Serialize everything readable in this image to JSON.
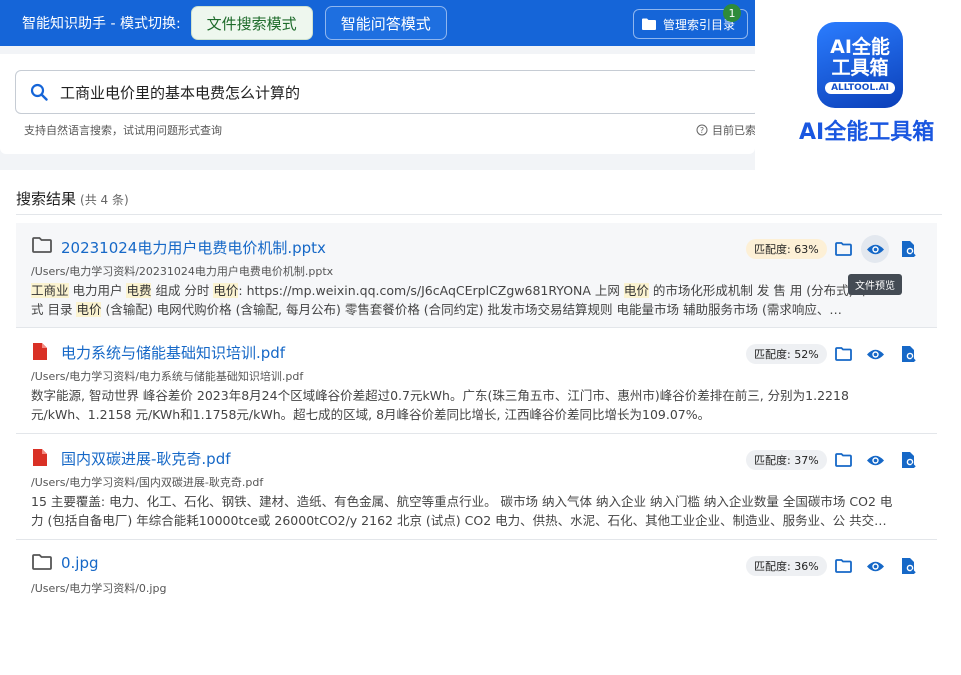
{
  "header": {
    "title": "智能知识助手 - 模式切换:",
    "mode_file_search": "文件搜索模式",
    "mode_qa": "智能问答模式",
    "manage_index": "管理索引目录",
    "badge_count": "1"
  },
  "search": {
    "query": "工商业电价里的基本电费怎么计算的",
    "hint": "支持自然语言搜索，试试用问题形式查询",
    "status": "目前已索"
  },
  "logo": {
    "line1": "AI全能",
    "line2": "工具箱",
    "pill": "ALLTOOL.AI",
    "text": "AI全能工具箱"
  },
  "results": {
    "heading": "搜索结果",
    "count": "(共 4 条)",
    "tooltip": "文件预览",
    "items": [
      {
        "title": "20231024电力用户电费电价机制.pptx",
        "path": "/Users/电力学习资料/20231024电力用户电费电价机制.pptx",
        "match": "匹配度: 63%",
        "snippet": {
          "p1": "工商业",
          "p2": " 电力用户 ",
          "p3": "电费",
          "p4": " 组成 分时 ",
          "p5": "电价",
          "p6": ": https://mp.weixin.qq.com/s/J6cAqCErplCZgw681RYONA 上网 ",
          "p7": "电价",
          "p8": " 的市场化形成机制 发 售 用 (分布式) 中",
          "p9": "式 目录 ",
          "p10": "电价",
          "p11": " (含输配) 电网代购价格 (含输配, 每月公布) 零售套餐价格 (合同约定) 批发市场交易结算规则 电能量市场 辅助服务市场 (需求响应、…"
        }
      },
      {
        "title": "电力系统与储能基础知识培训.pdf",
        "path": "/Users/电力学习资料/电力系统与储能基础知识培训.pdf",
        "match": "匹配度: 52%",
        "snippet_l1": "数字能源, 智动世界 峰谷差价    2023年8月24个区域峰谷价差超过0.7元kWh。广东(珠三角五市、江门市、惠州市)峰谷价差排在前三, 分别为1.2218",
        "snippet_l2": "元/kWh、1.2158 元/KWh和1.1758元/kWh。超七成的区域, 8月峰谷价差同比增长, 江西峰谷价差同比增长为109.07%。"
      },
      {
        "title": "国内双碳进展-耿克奇.pdf",
        "path": "/Users/电力学习资料/国内双碳进展-耿克奇.pdf",
        "match": "匹配度: 37%",
        "snippet_l1": "15 主要覆盖: 电力、化工、石化、钢铁、建材、造纸、有色金属、航空等重点行业。 碳市场 纳入气体 纳入企业 纳入门槛 纳入企业数量 全国碳市场 CO2 电",
        "snippet_l2": "力 (包括自备电厂) 年综合能耗10000tce或 26000tCO2/y 2162 北京 (试点) CO2 电力、供热、水泥、石化、其他工业企业、制造业、服务业、公 共交…"
      },
      {
        "title": "0.jpg",
        "path": "/Users/电力学习资料/0.jpg",
        "match": "匹配度: 36%"
      }
    ]
  },
  "colors": {
    "topbar": "#1565d8",
    "link": "#1668c7",
    "pdf_red": "#d93025",
    "highlight": "#fbf3d0"
  }
}
